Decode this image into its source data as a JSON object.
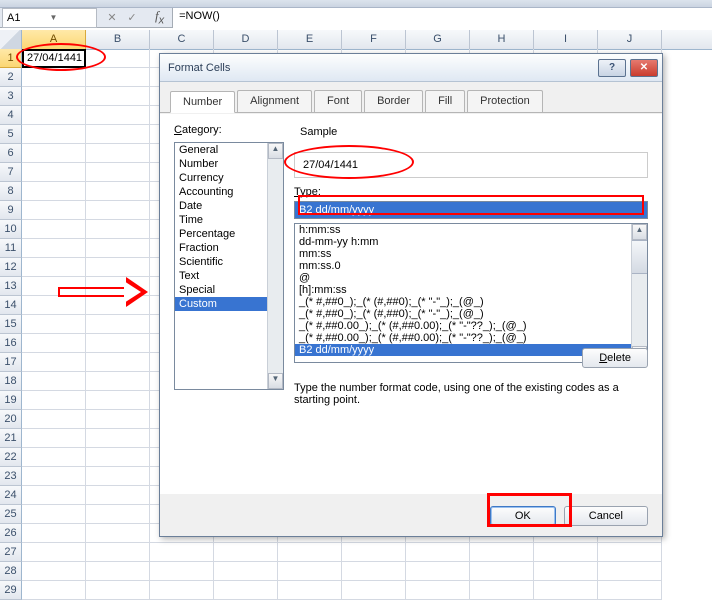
{
  "namebox": "A1",
  "formula": "=NOW()",
  "columns": [
    "A",
    "B",
    "C",
    "D",
    "E",
    "F",
    "G",
    "H",
    "I",
    "J"
  ],
  "rows": [
    "1",
    "2",
    "3",
    "4",
    "5",
    "6",
    "7",
    "8",
    "9",
    "10",
    "11",
    "12",
    "13",
    "14",
    "15",
    "16",
    "17",
    "18",
    "19",
    "20",
    "21",
    "22",
    "23",
    "24",
    "25",
    "26",
    "27",
    "28",
    "29"
  ],
  "cell_a1": "27/04/1441",
  "dialog": {
    "title": "Format Cells",
    "tabs": [
      "Number",
      "Alignment",
      "Font",
      "Border",
      "Fill",
      "Protection"
    ],
    "category_label": "Category:",
    "categories": [
      "General",
      "Number",
      "Currency",
      "Accounting",
      "Date",
      "Time",
      "Percentage",
      "Fraction",
      "Scientific",
      "Text",
      "Special",
      "Custom"
    ],
    "selected_category": "Custom",
    "sample_label": "Sample",
    "sample_value": "27/04/1441",
    "type_label": "Type:",
    "type_value": "B2 dd/mm/yyyy",
    "formats": [
      "h:mm:ss",
      "dd-mm-yy h:mm",
      "mm:ss",
      "mm:ss.0",
      "@",
      "[h]:mm:ss",
      "_(* #,##0_);_(* (#,##0);_(* \"-\"_);_(@_)",
      "_(* #,##0_);_(* (#,##0);_(* \"-\"_);_(@_)",
      "_(* #,##0.00_);_(* (#,##0.00);_(* \"-\"??_);_(@_)",
      "_(* #,##0.00_);_(* (#,##0.00);_(* \"-\"??_);_(@_)",
      "B2 dd/mm/yyyy"
    ],
    "selected_format": "B2 dd/mm/yyyy",
    "delete_label": "Delete",
    "hint": "Type the number format code, using one of the existing codes as a starting point.",
    "ok_label": "OK",
    "cancel_label": "Cancel",
    "help_glyph": "?",
    "close_glyph": "✕"
  }
}
